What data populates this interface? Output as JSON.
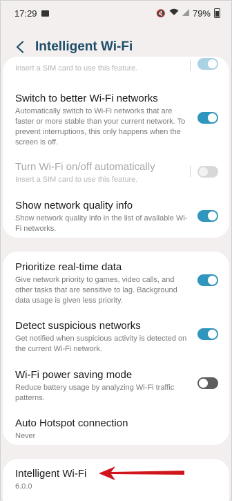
{
  "status": {
    "time": "17:29",
    "battery": "79%",
    "icons": [
      "gallery-icon",
      "mute-icon",
      "wifi-icon",
      "signal-icon",
      "battery-icon"
    ]
  },
  "header": {
    "title": "Intelligent Wi-Fi"
  },
  "partial_top": {
    "desc": "Insert a SIM card to use this feature.",
    "toggle": "on-faded"
  },
  "rows_group1": [
    {
      "title": "Switch to better Wi-Fi networks",
      "desc": "Automatically switch to Wi-Fi networks that are faster or more stable than your current network. To prevent interruptions, this only happens when the screen is off.",
      "toggle": "on"
    },
    {
      "title": "Turn Wi-Fi on/off automatically",
      "desc": "Insert a SIM card to use this feature.",
      "toggle": "disabled"
    },
    {
      "title": "Show network quality info",
      "desc": "Show network quality info in the list of available Wi-Fi networks.",
      "toggle": "on"
    }
  ],
  "rows_group2": [
    {
      "title": "Prioritize real-time data",
      "desc": "Give network priority to games, video calls, and other tasks that are sensitive to lag. Background data usage is given less priority.",
      "toggle": "on"
    },
    {
      "title": "Detect suspicious networks",
      "desc": "Get notified when suspicious activity is detected on the current Wi-Fi network.",
      "toggle": "on"
    },
    {
      "title": "Wi-Fi power saving mode",
      "desc": "Reduce battery usage by analyzing Wi-Fi traffic patterns.",
      "toggle": "off"
    },
    {
      "title": "Auto Hotspot connection",
      "desc": "Never"
    }
  ],
  "about": {
    "title": "Intelligent Wi-Fi",
    "version": "6.0.0"
  },
  "colors": {
    "accent": "#3196bd",
    "title": "#1d4d6a",
    "arrow": "#d0151c",
    "background": "#f3efee"
  }
}
